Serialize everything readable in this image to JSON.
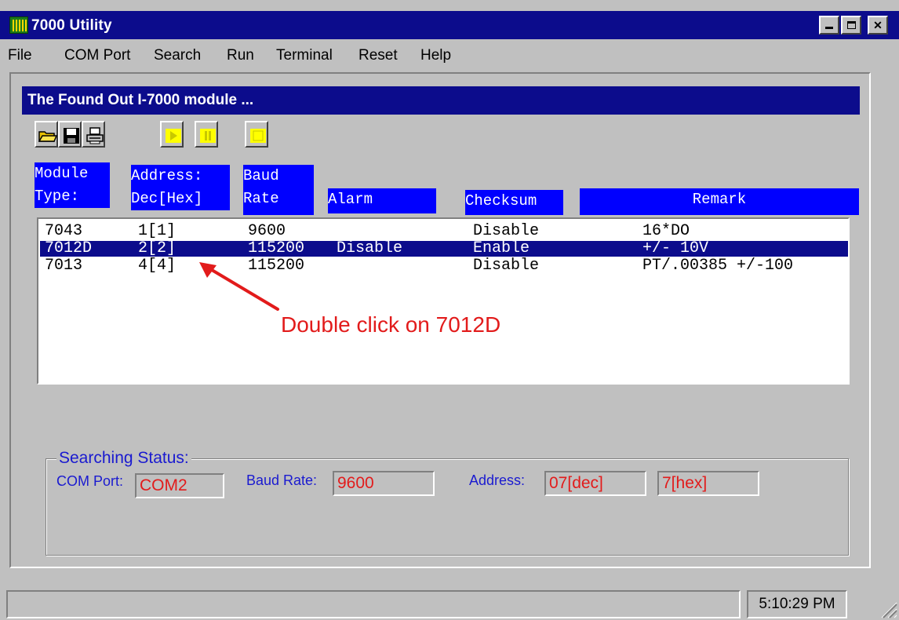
{
  "window": {
    "title": "7000 Utility"
  },
  "menu": [
    "File",
    "COM Port",
    "Search",
    "Run",
    "Terminal",
    "Reset",
    "Help"
  ],
  "child_window": {
    "title": "The Found Out I-7000 module ..."
  },
  "toolbar": [
    "open-folder-icon",
    "save-disk-icon",
    "print-icon",
    "play-icon",
    "pause-icon",
    "stop-icon"
  ],
  "columns": {
    "module_type": "Module\nType:",
    "address": "Address:\nDec[Hex]",
    "baud": "Baud\nRate",
    "alarm": "Alarm",
    "checksum": "Checksum",
    "remark": "Remark"
  },
  "rows": [
    {
      "module": "7043",
      "address": "1[1]",
      "baud": "9600",
      "alarm": "",
      "checksum": "Disable",
      "remark": "16*DO",
      "selected": false
    },
    {
      "module": "7012D",
      "address": "2[2]",
      "baud": "115200",
      "alarm": "Disable",
      "checksum": "Enable",
      "remark": "+/- 10V",
      "selected": true
    },
    {
      "module": "7013",
      "address": "4[4]",
      "baud": "115200",
      "alarm": "",
      "checksum": "Disable",
      "remark": "PT/.00385 +/-100",
      "selected": false
    }
  ],
  "annotation": {
    "text": "Double click on 7012D",
    "color": "#e21b1b"
  },
  "searching_status": {
    "legend": "Searching Status:",
    "com_port_label": "COM Port:",
    "com_port_value": "COM2",
    "baud_label": "Baud Rate:",
    "baud_value": "9600",
    "address_label": "Address:",
    "address_dec": "07[dec]",
    "address_hex": "7[hex]"
  },
  "statusbar": {
    "time": "5:10:29 PM"
  },
  "colors": {
    "title_bar": "#0c0c8c",
    "header_bg": "#0000ff",
    "status_label": "#1a1ad0",
    "status_value": "#e21b1b",
    "face": "#c0c0c0"
  }
}
